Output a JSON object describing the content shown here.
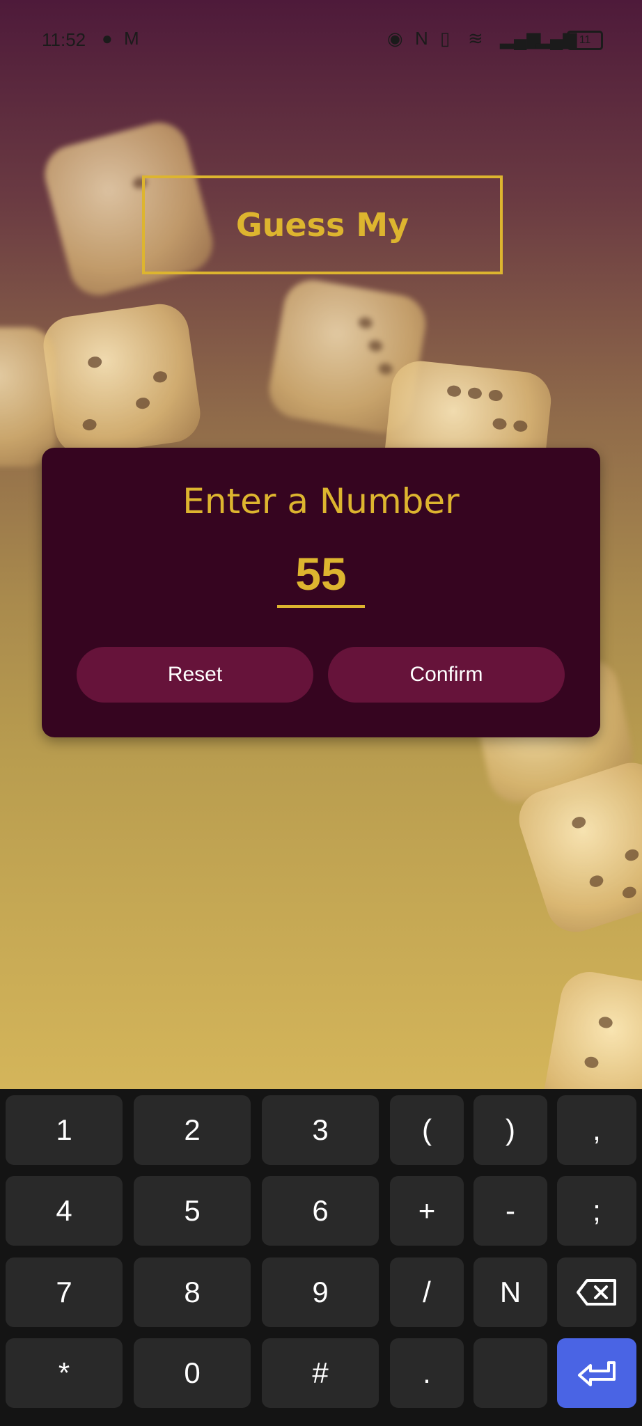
{
  "status_bar": {
    "time": "11:52",
    "icons": [
      "messenger-icon",
      "gmail-icon",
      "eye-icon",
      "nfc-icon",
      "vibrate-icon",
      "wifi-icon",
      "signal-icon",
      "signal-icon",
      "battery-icon"
    ],
    "battery": "11"
  },
  "title": "Guess My",
  "card": {
    "heading": "Enter a Number",
    "input_value": "55",
    "reset_label": "Reset",
    "confirm_label": "Confirm"
  },
  "colors": {
    "accent": "#ddb52f",
    "card_bg": "#360520",
    "button_bg": "#66133a",
    "enter_key": "#4a64e4",
    "keyboard_bg": "#141414"
  },
  "keyboard": {
    "rows": [
      [
        "1",
        "2",
        "3",
        "(",
        ")",
        ","
      ],
      [
        "4",
        "5",
        "6",
        "+",
        "-",
        ";"
      ],
      [
        "7",
        "8",
        "9",
        "/",
        "N",
        "backspace-icon"
      ],
      [
        "*",
        "0",
        "#",
        ".",
        "",
        "enter-icon"
      ]
    ]
  }
}
